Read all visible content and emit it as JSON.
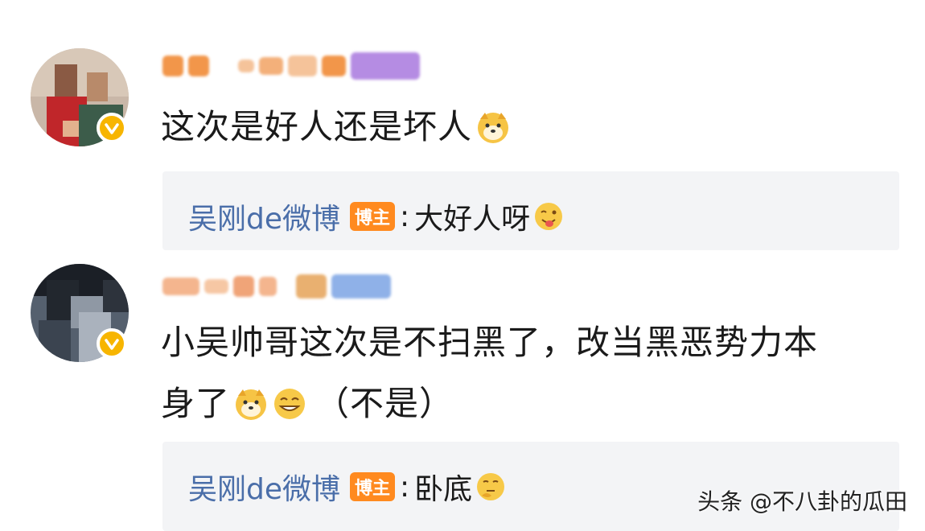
{
  "comments": [
    {
      "text": "这次是好人还是坏人",
      "reply": {
        "author": "吴刚de微博",
        "badge": "博主",
        "colon": ":",
        "text": "大好人呀"
      }
    },
    {
      "text_line1": "小吴帅哥这次是不扫黑了，改当黑恶势力本",
      "text_line2": "身了",
      "text_suffix": "（不是）",
      "reply": {
        "author": "吴刚de微博",
        "badge": "博主",
        "colon": ":",
        "text": "卧底"
      }
    }
  ],
  "watermark": "头条 @不八卦的瓜田",
  "colors": {
    "link": "#4a6ea9",
    "badge": "#ff8a1f",
    "verify": "#f7b500",
    "reply_bg": "#f3f4f6"
  },
  "icons": [
    "verified-badge-icon",
    "doge-emoji-icon",
    "tongue-emoji-icon",
    "grin-emoji-icon",
    "thinking-emoji-icon"
  ]
}
